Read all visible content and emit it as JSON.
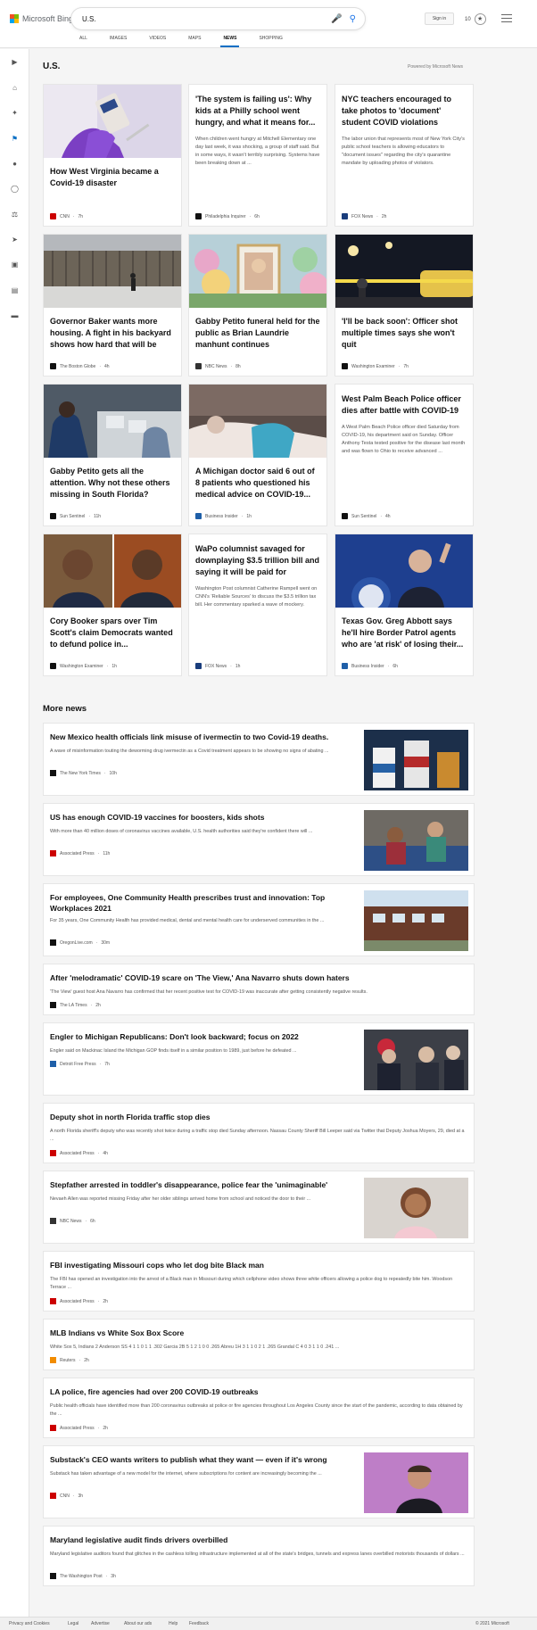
{
  "header": {
    "logo_text": "Microsoft Bing",
    "search_value": "U.S.",
    "sign_in": "Sign in",
    "rewards_points": "10",
    "tabs": [
      "ALL",
      "IMAGES",
      "VIDEOS",
      "MAPS",
      "NEWS",
      "SHOPPING"
    ],
    "active_tab": "NEWS"
  },
  "section": {
    "title": "U.S.",
    "powered_by": "Powered by Microsoft News"
  },
  "cards": [
    {
      "title": "How West Virginia became a Covid-19 disaster",
      "desc": "",
      "source": "CNN",
      "time": "7h",
      "color": "#cc0000"
    },
    {
      "title": "'The system is failing us': Why kids at a Philly school went hungry, and what it means for...",
      "desc": "When children went hungry at Mitchell Elementary one day last week, it was shocking, a group of staff said. But in some ways, it wasn't terribly surprising. Systems have been breaking down at ...",
      "source": "Philadelphia Inquirer",
      "time": "6h",
      "color": "#111111"
    },
    {
      "title": "NYC teachers encouraged to take photos to 'document' student COVID violations",
      "desc": "The labor union that represents most of New York City's public school teachers is allowing educators to \"document issues\" regarding the city's quarantine mandate by uploading photos of violators.",
      "source": "FOX News",
      "time": "2h",
      "color": "#1a3d7c"
    },
    {
      "title": "Governor Baker wants more housing. A fight in his backyard shows how hard that will be",
      "desc": "",
      "source": "The Boston Globe",
      "time": "4h",
      "color": "#111111"
    },
    {
      "title": "Gabby Petito funeral held for the public as Brian Laundrie manhunt continues",
      "desc": "",
      "source": "NBC News",
      "time": "8h",
      "color": "#333333"
    },
    {
      "title": "'I'll be back soon': Officer shot multiple times says she won't quit",
      "desc": "",
      "source": "Washington Examiner",
      "time": "7h",
      "color": "#111111"
    },
    {
      "title": "Gabby Petito gets all the attention. Why not these others missing in South Florida?",
      "desc": "",
      "source": "Sun Sentinel",
      "time": "11h",
      "color": "#111111"
    },
    {
      "title": "A Michigan doctor said 6 out of 8 patients who questioned his medical advice on COVID-19...",
      "desc": "",
      "source": "Business Insider",
      "time": "1h",
      "color": "#1f5fa8"
    },
    {
      "title": "West Palm Beach Police officer dies after battle with COVID-19",
      "desc": "A West Palm Beach Police officer died Saturday from COVID-19, his department said on Sunday. Officer Anthony Testa tested positive for the disease last month and was flown to Ohio to receive advanced ...",
      "source": "Sun Sentinel",
      "time": "4h",
      "color": "#111111"
    },
    {
      "title": "Cory Booker spars over Tim Scott's claim Democrats wanted to defund police in...",
      "desc": "",
      "source": "Washington Examiner",
      "time": "1h",
      "color": "#111111"
    },
    {
      "title": "WaPo columnist savaged for downplaying $3.5 trillion bill and saying it will be paid for",
      "desc": "Washington Post columnist Catherine Rampell went on CNN's 'Reliable Sources' to discuss the $3.5 trillion tax bill. Her commentary sparked a wave of mockery.",
      "source": "FOX News",
      "time": "1h",
      "color": "#1a3d7c"
    },
    {
      "title": "Texas Gov. Greg Abbott says he'll hire Border Patrol agents who are 'at risk' of losing their...",
      "desc": "",
      "source": "Business Insider",
      "time": "6h",
      "color": "#1f5fa8"
    }
  ],
  "more_news": {
    "title": "More news",
    "items": [
      {
        "title": "New Mexico health officials link misuse of ivermectin to two Covid-19 deaths.",
        "desc": "A wave of misinformation touting the deworming drug ivermectin as a Covid treatment appears to be showing no signs of abating ...",
        "source": "The New York Times",
        "time": "10h",
        "color": "#111111"
      },
      {
        "title": "US has enough COVID-19 vaccines for boosters, kids shots",
        "desc": "With more than 40 million doses of coronavirus vaccines available, U.S. health authorities said they're confident there will ...",
        "source": "Associated Press",
        "time": "11h",
        "color": "#cc0000"
      },
      {
        "title": "For employees, One Community Health prescribes trust and innovation: Top Workplaces 2021",
        "desc": "For 35 years, One Community Health has provided medical, dental and mental health care for underserved communities in the ...",
        "source": "OregonLive.com",
        "time": "30m",
        "color": "#111111"
      },
      {
        "title": "After 'melodramatic' COVID-19 scare on 'The View,' Ana Navarro shuts down haters",
        "desc": "'The View' guest host Ana Navarro has confirmed that her recent positive test for COVID-19 was inaccurate after getting consistently negative results.",
        "source": "The LA Times",
        "time": "2h",
        "color": "#111111"
      },
      {
        "title": "Engler to Michigan Republicans: Don't look backward; focus on 2022",
        "desc": "Engler said on Mackinac Island the Michigan GOP finds itself in a similar position to 1989, just before he defeated ...",
        "source": "Detroit Free Press",
        "time": "7h",
        "color": "#1f5fa8"
      },
      {
        "title": "Deputy shot in north Florida traffic stop dies",
        "desc": "A north Florida sheriff's deputy who was recently shot twice during a traffic stop died Sunday afternoon. Nassau County Sheriff Bill Leeper said via Twitter that Deputy Joshua Moyers, 29, died at a ...",
        "source": "Associated Press",
        "time": "4h",
        "color": "#cc0000"
      },
      {
        "title": "Stepfather arrested in toddler's disappearance, police fear the 'unimaginable'",
        "desc": "Nevaeh Allen was reported missing Friday after her older siblings arrived home from school and noticed the door to their ...",
        "source": "NBC News",
        "time": "6h",
        "color": "#333333"
      },
      {
        "title": "FBI investigating Missouri cops who let dog bite Black man",
        "desc": "The FBI has opened an investigation into the arrest of a Black man in Missouri during which cellphone video shows three white officers allowing a police dog to repeatedly bite him. Woodson Terrace ...",
        "source": "Associated Press",
        "time": "2h",
        "color": "#cc0000"
      },
      {
        "title": "MLB Indians vs White Sox Box Score",
        "desc": "White Sox 5, Indians 2 Anderson SS 4 1 1 0 1 1 .302 Garcia 2B 5 1 2 1 0 0 .265 Abreu 1H 3 1 1 0 2 1 .265 Grandal C 4 0 3 1 1 0 .241 ...",
        "source": "Reuters",
        "time": "2h",
        "color": "#f28c00"
      },
      {
        "title": "LA police, fire agencies had over 200 COVID-19 outbreaks",
        "desc": "Public health officials have identified more than 200 coronavirus outbreaks at police or fire agencies throughout Los Angeles County since the start of the pandemic, according to data obtained by the ...",
        "source": "Associated Press",
        "time": "2h",
        "color": "#cc0000"
      },
      {
        "title": "Substack's CEO wants writers to publish what they want — even if it's wrong",
        "desc": "Substack has taken advantage of a new model for the internet, where subscriptions for content are increasingly becoming the ...",
        "source": "CNN",
        "time": "3h",
        "color": "#cc0000"
      },
      {
        "title": "Maryland legislative audit finds drivers overbilled",
        "desc": "Maryland legislative auditors found that glitches in the cashless tolling infrastructure implemented at all of the state's bridges, tunnels and express lanes overbilled motorists thousands of dollars ...",
        "source": "The Washington Post",
        "time": "3h",
        "color": "#111111"
      }
    ]
  },
  "footer": {
    "links": [
      "Privacy and Cookies",
      "Legal",
      "Advertise",
      "About our ads",
      "Help",
      "Feedback"
    ],
    "copyright": "© 2021 Microsoft"
  },
  "colors": {
    "accent": "#0a6fc4",
    "background": "#f5f5f5"
  }
}
